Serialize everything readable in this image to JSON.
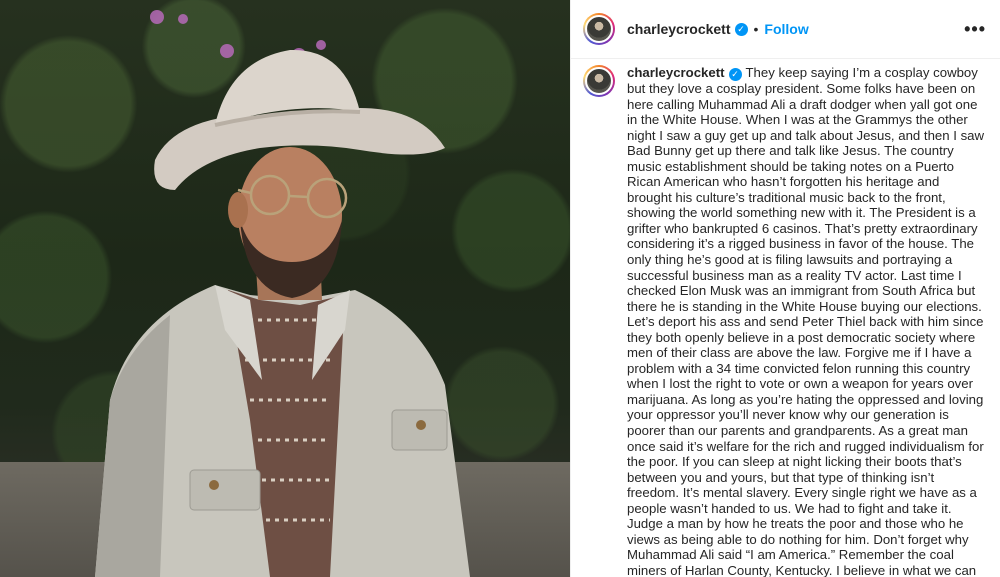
{
  "post": {
    "username": "charleycrockett",
    "separator": "•",
    "follow_label": "Follow",
    "more_label": "•••",
    "verified_mark": "✓"
  },
  "caption": {
    "username": "charleycrockett",
    "text": "They keep saying I’m a cosplay cowboy but they love a cosplay president. Some folks have been on here calling Muhammad Ali a draft dodger when yall got one in the White House. When I was at the Grammys the other night I saw a guy get up and talk about Jesus, and then I saw Bad Bunny get up there and talk like Jesus. The country music establishment should be taking notes on a Puerto Rican American who hasn’t forgotten his heritage and brought his culture’s traditional music back to the front, showing the world something new with it. The President is a grifter who bankrupted 6 casinos. That’s pretty extraordinary considering it’s a rigged business in favor of the house. The only thing he’s good at is filing lawsuits and portraying a successful business man as a reality TV actor. Last time I checked Elon Musk was an immigrant from South Africa but there he is standing in the White House buying our elections. Let’s deport his ass and send Peter Thiel back with him since they both openly believe in a post democratic society where men of their class are above the law. Forgive me if I have a problem with a 34 time convicted felon running this country when I lost the right to vote or own a weapon for years over marijuana. As long as you’re hating the oppressed and loving your oppressor you’ll never know why our generation is poorer than our parents and grandparents. As a great man once said it’s welfare for the rich and rugged individualism for the poor. If you can sleep at night licking their boots that’s between you and yours, but that type of thinking isn’t freedom. It’s mental slavery. Every single right we have as a people wasn’t handed to us. We had to fight and take it. Judge a man by how he treats the poor and those who he views as being able to do nothing for him. Don’t forget why Muhammad Ali said “I am America.” Remember the coal miners of Harlan County, Kentucky. I believe in what we can be. Ride on. 🦖"
  },
  "icons": {
    "avatar": "profile-avatar",
    "verified": "verified-badge-icon",
    "more": "more-options-icon"
  },
  "colors": {
    "accent": "#0095f6",
    "text": "#262626",
    "border": "#efefef"
  }
}
